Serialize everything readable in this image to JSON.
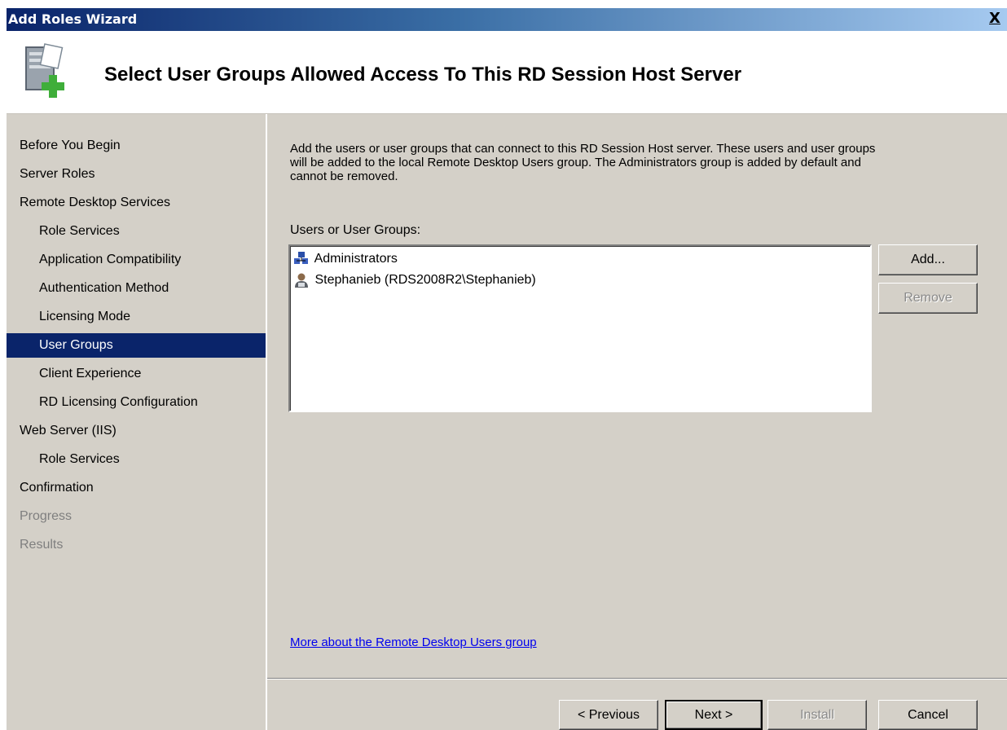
{
  "window": {
    "title": "Add Roles Wizard",
    "close_label": "X"
  },
  "header": {
    "heading": "Select User Groups Allowed Access To This RD Session Host Server",
    "icon": "server-add-icon"
  },
  "nav": {
    "items": [
      {
        "label": "Before You Begin",
        "state": "normal"
      },
      {
        "label": "Server Roles",
        "state": "normal"
      },
      {
        "label": "Remote Desktop Services",
        "state": "normal"
      },
      {
        "label": "Role Services",
        "state": "normal"
      },
      {
        "label": "Application Compatibility",
        "state": "normal"
      },
      {
        "label": "Authentication Method",
        "state": "normal"
      },
      {
        "label": "Licensing Mode",
        "state": "normal"
      },
      {
        "label": "User Groups",
        "state": "selected"
      },
      {
        "label": "Client Experience",
        "state": "normal"
      },
      {
        "label": "RD Licensing Configuration",
        "state": "normal"
      },
      {
        "label": "Web Server (IIS)",
        "state": "normal"
      },
      {
        "label": "Role Services",
        "state": "normal"
      },
      {
        "label": "Confirmation",
        "state": "normal"
      },
      {
        "label": "Progress",
        "state": "disabled"
      },
      {
        "label": "Results",
        "state": "disabled"
      }
    ]
  },
  "content": {
    "description_line1": "Add the users or user groups that can connect to this RD Session Host server. These users and user groups",
    "description_line2": "will be added to the local Remote Desktop Users group. The Administrators group is added by default and",
    "description_line3": "cannot be removed.",
    "list_label": "Users or User Groups:",
    "list_items": [
      {
        "label": "Administrators",
        "icon": "user-group-icon"
      },
      {
        "label": "Stephanieb (RDS2008R2\\Stephanieb)",
        "icon": "user-icon"
      }
    ],
    "add_label": "Add...",
    "remove_label": "Remove",
    "link_text": "More about the Remote Desktop Users group"
  },
  "footer": {
    "previous_label": "< Previous",
    "next_label": "Next >",
    "install_label": "Install",
    "cancel_label": "Cancel"
  },
  "colors": {
    "title_gradient_start": "#0a246a",
    "title_gradient_end": "#a6caf0",
    "selection": "#0a246a",
    "face": "#d4d0c8",
    "link": "#0000ee"
  }
}
